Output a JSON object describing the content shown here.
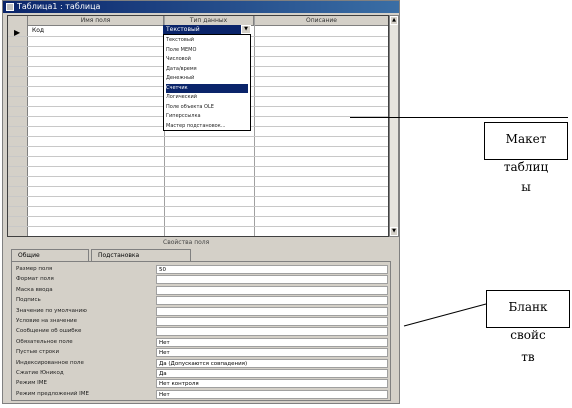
{
  "window": {
    "title": "Таблица1 : таблица"
  },
  "grid": {
    "headers": [
      "Имя поля",
      "Тип данных",
      "Описание"
    ],
    "first_row_value": "Код",
    "combo_value": "Текстовый"
  },
  "type_dropdown": {
    "items": [
      "Текстовый",
      "Поле MEMO",
      "Числовой",
      "Дата/время",
      "Денежный",
      "Счетчик",
      "Логический",
      "Поле объекта OLE",
      "Гиперссылка",
      "Мастер подстановок..."
    ],
    "selected_index": 5
  },
  "section_label": "Свойства поля",
  "tabs": [
    "Общие",
    "Подстановка"
  ],
  "properties": [
    {
      "name": "Размер поля",
      "value": "50"
    },
    {
      "name": "Формат поля",
      "value": ""
    },
    {
      "name": "Маска ввода",
      "value": ""
    },
    {
      "name": "Подпись",
      "value": ""
    },
    {
      "name": "Значение по умолчанию",
      "value": ""
    },
    {
      "name": "Условие на значение",
      "value": ""
    },
    {
      "name": "Сообщение об ошибке",
      "value": ""
    },
    {
      "name": "Обязательное поле",
      "value": "Нет"
    },
    {
      "name": "Пустые строки",
      "value": "Нет"
    },
    {
      "name": "Индексированное поле",
      "value": "Да (Допускаются совпадения)"
    },
    {
      "name": "Сжатие Юникод",
      "value": "Да"
    },
    {
      "name": "Режим IME",
      "value": "Нет контроля"
    },
    {
      "name": "Режим предложений IME",
      "value": "Нет"
    }
  ],
  "callouts": {
    "layout_label_box": "Макет",
    "layout_label_rest": [
      "таблиц",
      "ы"
    ],
    "props_label_box": "Бланк",
    "props_label_rest": [
      "свойс",
      "тв"
    ]
  }
}
